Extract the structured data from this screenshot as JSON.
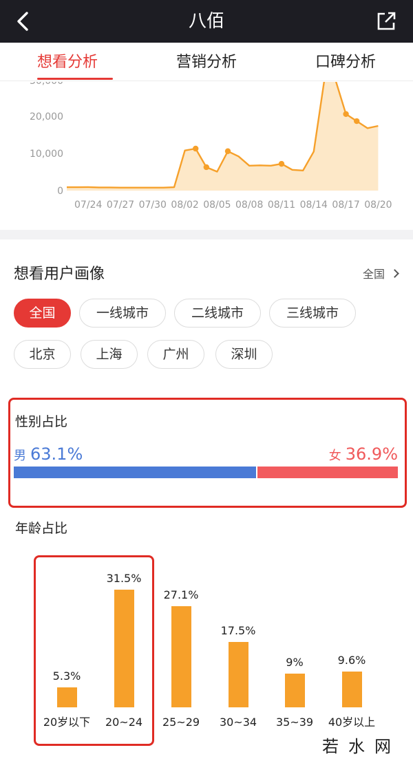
{
  "header": {
    "title": "八佰",
    "back_icon": "chevron-left-icon",
    "share_icon": "share-icon"
  },
  "tabs": [
    {
      "label": "想看分析",
      "active": true
    },
    {
      "label": "营销分析",
      "active": false
    },
    {
      "label": "口碑分析",
      "active": false
    }
  ],
  "chart_data": {
    "type": "area",
    "y_ticks": [
      "10,000",
      "20,000",
      "0"
    ],
    "x_ticks": [
      "07/24",
      "07/27",
      "07/30",
      "08/02",
      "08/05",
      "08/08",
      "08/11",
      "08/14",
      "08/17",
      "08/20"
    ],
    "ylim": [
      0,
      30000
    ],
    "line_color": "#f6a02a",
    "fill_color": "#fde8c8",
    "dates": [
      "07/22",
      "07/23",
      "07/24",
      "07/25",
      "07/26",
      "07/27",
      "07/28",
      "07/29",
      "07/30",
      "07/31",
      "08/01",
      "08/02",
      "08/03",
      "08/04",
      "08/05",
      "08/06",
      "08/07",
      "08/08",
      "08/09",
      "08/10",
      "08/11",
      "08/12",
      "08/13",
      "08/14",
      "08/15",
      "08/16",
      "08/17",
      "08/18",
      "08/19",
      "08/20"
    ],
    "values": [
      900,
      900,
      950,
      850,
      850,
      800,
      800,
      800,
      800,
      800,
      900,
      10800,
      11300,
      6300,
      5100,
      10600,
      9200,
      6700,
      6800,
      6700,
      7200,
      5600,
      5400,
      10500,
      30000,
      30000,
      20600,
      18700,
      16800,
      17400
    ],
    "markers": [
      "08/03",
      "08/04",
      "08/06",
      "08/11",
      "08/17",
      "08/18"
    ]
  },
  "portrait": {
    "title": "想看用户画像",
    "scope_label": "全国",
    "scope_icon": "chevron-right-icon",
    "chips": [
      {
        "label": "全国",
        "active": true
      },
      {
        "label": "一线城市",
        "active": false
      },
      {
        "label": "二线城市",
        "active": false
      },
      {
        "label": "三线城市",
        "active": false
      },
      {
        "label": "北京",
        "active": false
      },
      {
        "label": "上海",
        "active": false
      },
      {
        "label": "广州",
        "active": false
      },
      {
        "label": "深圳",
        "active": false
      }
    ]
  },
  "gender": {
    "title": "性别占比",
    "male_label": "男",
    "male_pct_text": "63.1%",
    "male_pct": 63.1,
    "female_label": "女",
    "female_pct_text": "36.9%",
    "female_pct": 36.9,
    "male_color": "#4a7ad6",
    "female_color": "#f25b5e"
  },
  "age": {
    "title": "年龄占比",
    "bar_color": "#f6a02a",
    "items": [
      {
        "category": "20岁以下",
        "value": 5.3,
        "label": "5.3%"
      },
      {
        "category": "20~24",
        "value": 31.5,
        "label": "31.5%"
      },
      {
        "category": "25~29",
        "value": 27.1,
        "label": "27.1%"
      },
      {
        "category": "30~34",
        "value": 17.5,
        "label": "17.5%"
      },
      {
        "category": "35~39",
        "value": 9,
        "label": "9%"
      },
      {
        "category": "40岁以上",
        "value": 9.6,
        "label": "9.6%"
      }
    ]
  },
  "watermark": "若水网",
  "colors": {
    "accent": "#e53935",
    "highlight_box": "#e02b24"
  }
}
